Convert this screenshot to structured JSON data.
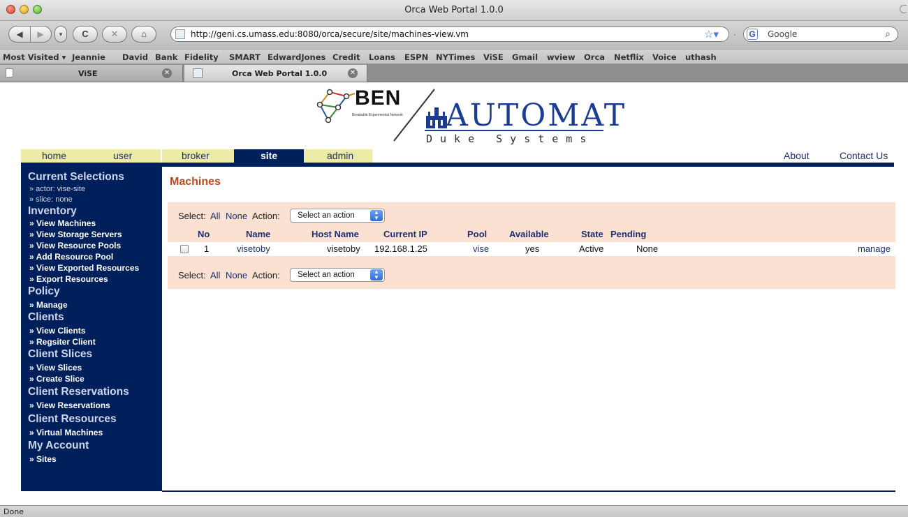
{
  "window": {
    "title": "Orca Web Portal 1.0.0"
  },
  "toolbar": {
    "url": "http://geni.cs.umass.edu:8080/orca/secure/site/machines-view.vm",
    "search_placeholder": "Google",
    "back_label": "◀",
    "forward_label": "▶",
    "reload_label": "C",
    "stop_label": "✕",
    "home_label": "⌂"
  },
  "bookmarks": [
    "Most Visited ▾",
    "Jeannie",
    "David",
    "Bank",
    "Fidelity",
    "SMART",
    "EdwardJones",
    "Credit",
    "Loans",
    "ESPN",
    "NYTimes",
    "ViSE",
    "Gmail",
    "wview",
    "Orca",
    "Netflix",
    "Voice",
    "uthash"
  ],
  "tabs": [
    {
      "label": "ViSE",
      "active": false
    },
    {
      "label": "Orca Web Portal 1.0.0",
      "active": true
    }
  ],
  "logos": {
    "ben": "BEN",
    "ben_sub": "Breakable Experimental Network",
    "automat": "AUTOMAT",
    "duke": "Duke Systems"
  },
  "nav": {
    "tabs": [
      "home",
      "user",
      "broker",
      "site",
      "admin"
    ],
    "active": "site",
    "right_links": [
      "About",
      "Contact Us"
    ]
  },
  "sidebar": {
    "current_selections": {
      "title": "Current Selections",
      "actor": "» actor: vise-site",
      "slice": "» slice: none"
    },
    "sections": [
      {
        "title": "Inventory",
        "items": [
          "» View Machines",
          "» View Storage Servers",
          "» View Resource Pools",
          "» Add Resource Pool",
          "» View Exported Resources",
          "» Export Resources"
        ]
      },
      {
        "title": "Policy",
        "items": [
          "» Manage"
        ]
      },
      {
        "title": "Clients",
        "items": [
          "» View Clients",
          "» Regsiter Client"
        ]
      },
      {
        "title": "Client Slices",
        "items": [
          "» View Slices",
          "» Create Slice"
        ]
      },
      {
        "title": "Client Reservations",
        "items": [
          "» View Reservations"
        ]
      },
      {
        "title": "Client Resources",
        "items": [
          "» Virtual Machines"
        ]
      },
      {
        "title": "My Account",
        "items": [
          "» Sites"
        ]
      }
    ]
  },
  "main": {
    "title": "Machines",
    "controls": {
      "select_label": "Select:",
      "all": "All",
      "none": "None",
      "action_label": "Action:",
      "action_select": "Select an action"
    },
    "columns": [
      "No",
      "Name",
      "Host Name",
      "Current IP",
      "Pool",
      "Available",
      "State",
      "Pending"
    ],
    "rows": [
      {
        "no": "1",
        "name": "visetoby",
        "host": "visetoby",
        "ip": "192.168.1.25",
        "pool": "vise",
        "available": "yes",
        "state": "Active",
        "pending": "None",
        "action": "manage"
      }
    ]
  },
  "status": {
    "text": "Done"
  },
  "colors": {
    "navy": "#00205c",
    "khaki": "#ececa8",
    "panel": "#fbe1d1",
    "title_orange": "#c04a1c",
    "link_blue": "#1e2e6e"
  }
}
